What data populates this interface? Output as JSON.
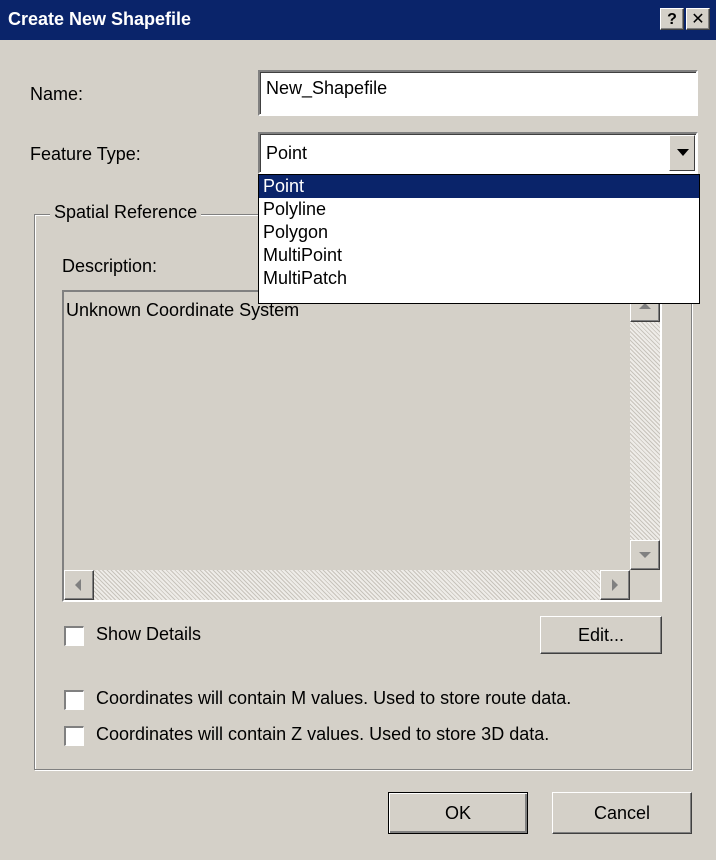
{
  "window": {
    "title": "Create New Shapefile",
    "help_label": "?",
    "close_label": "✕"
  },
  "name": {
    "label": "Name:",
    "value": "New_Shapefile"
  },
  "feature_type": {
    "label": "Feature Type:",
    "selected": "Point",
    "options": [
      "Point",
      "Polyline",
      "Polygon",
      "MultiPoint",
      "MultiPatch"
    ]
  },
  "spatial_reference": {
    "group_label": "Spatial Reference",
    "description_label": "Description:",
    "description_text": "Unknown Coordinate System",
    "show_details_label": "Show Details",
    "edit_label": "Edit..."
  },
  "options": {
    "m_values_label": "Coordinates will contain M values. Used to store route data.",
    "z_values_label": "Coordinates will contain Z values. Used to store 3D data."
  },
  "buttons": {
    "ok_label": "OK",
    "cancel_label": "Cancel"
  }
}
